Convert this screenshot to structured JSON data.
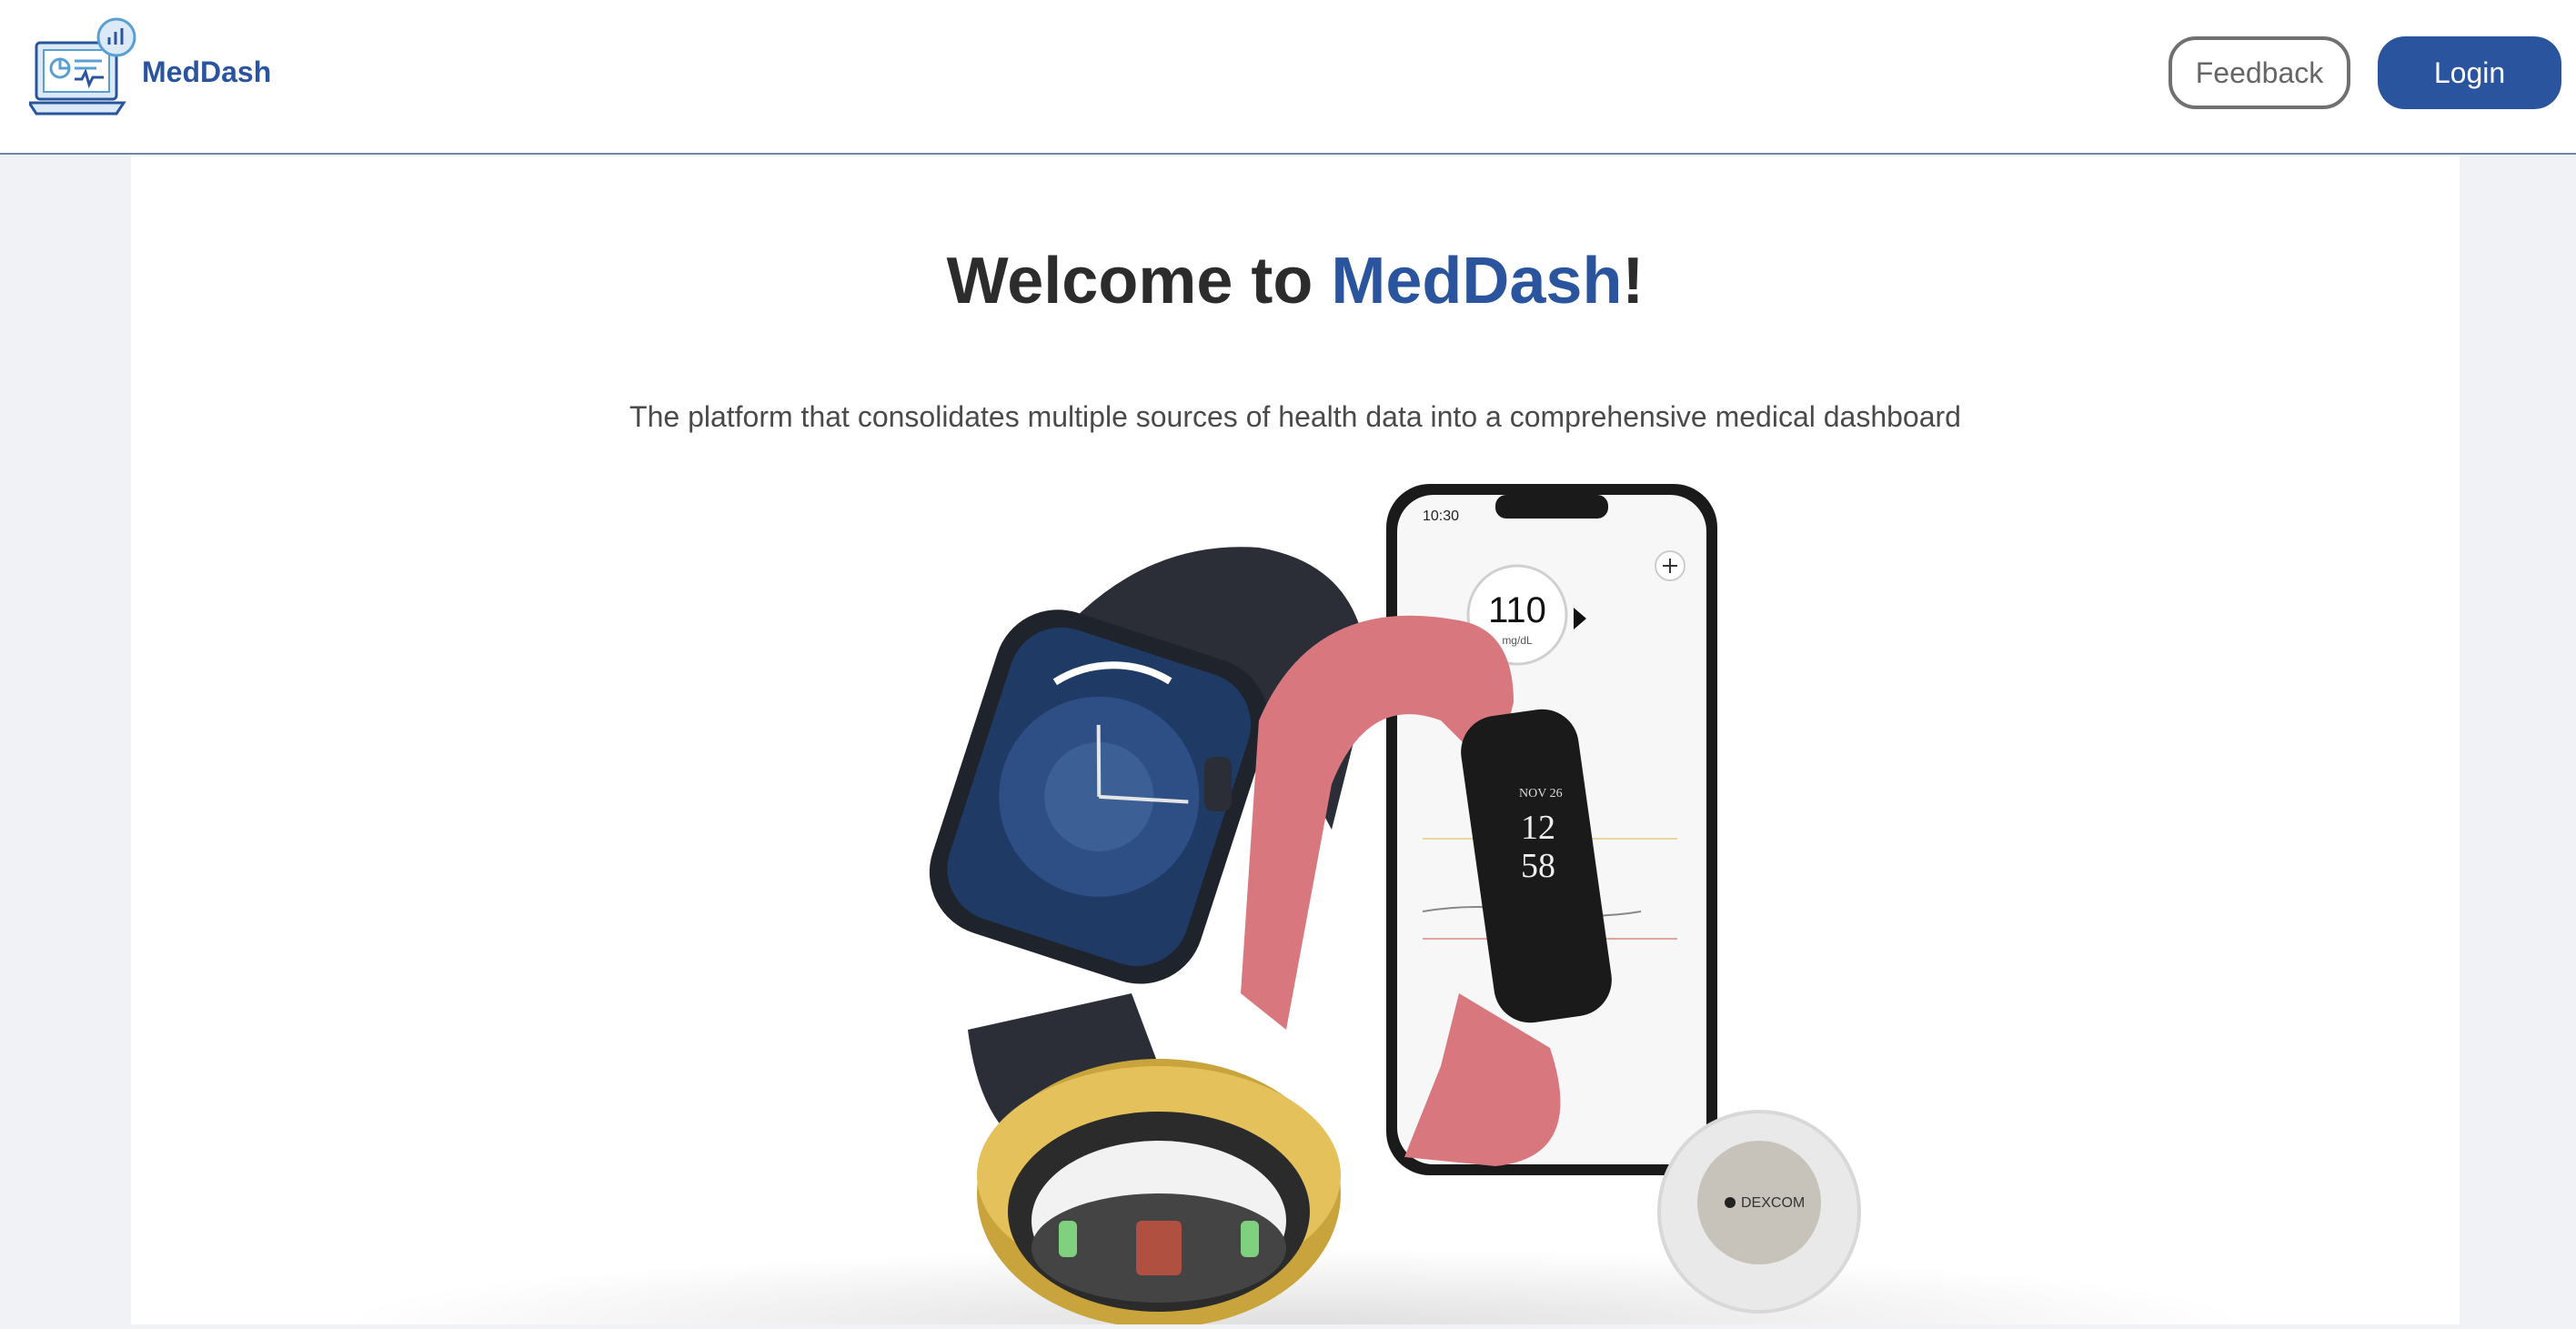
{
  "header": {
    "brand_name": "MedDash",
    "feedback_label": "Feedback",
    "login_label": "Login"
  },
  "hero": {
    "title_prefix": "Welcome to ",
    "title_accent": "MedDash",
    "title_suffix": "!",
    "subtitle": "The platform that consolidates multiple sources of health data into a comprehensive medical dashboard",
    "image_alt": "wearable health devices: smartwatch, fitness band, smart ring, phone app, glucose sensor"
  },
  "colors": {
    "brand": "#2a559e",
    "page_bg": "#f0f2f5",
    "feedback_border": "#707070"
  },
  "devices": {
    "phone_time": "10:30",
    "phone_reading": "110",
    "phone_unit": "mg/dL",
    "band_date": "NOV 26",
    "band_hour": "12",
    "band_min": "58",
    "sensor_brand": "DEXCOM"
  }
}
